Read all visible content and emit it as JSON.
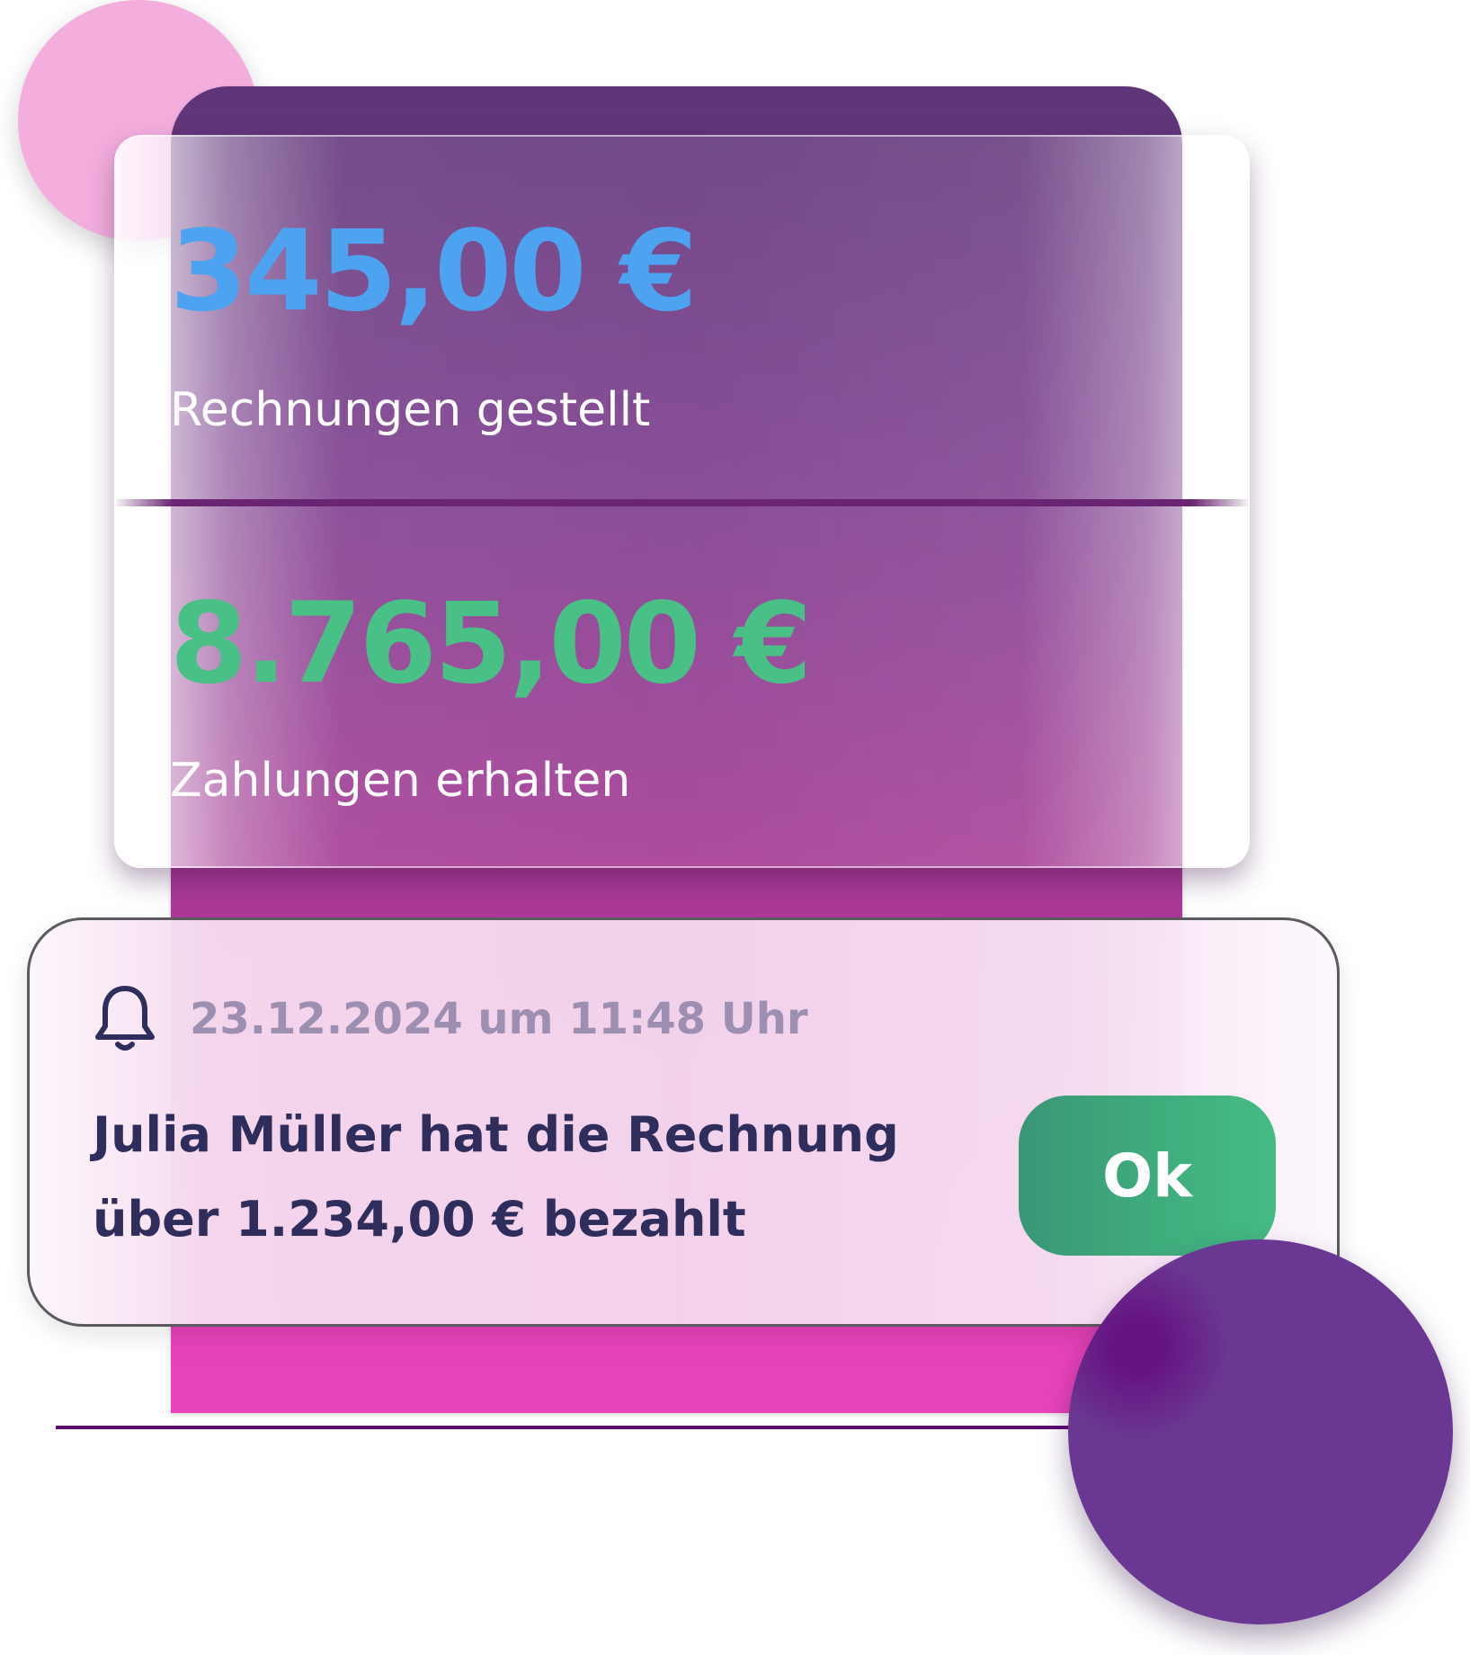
{
  "stats": {
    "invoiced_amount": "345,00 €",
    "invoiced_label": "Rechnungen gestellt",
    "received_amount": "8.765,00 €",
    "received_label": "Zahlungen erhalten"
  },
  "notification": {
    "icon": "bell-icon",
    "timestamp": "23.12.2024 um 11:48 Uhr",
    "message": "Julia Müller hat die Rechnung über 1.234,00 € bezahlt",
    "ok_label": "Ok"
  },
  "colors": {
    "invoiced_value": "#4da3f0",
    "received_value": "#49c186",
    "ok_button": "#3fab7c",
    "text_dark": "#2f2d5c",
    "text_muted": "#9d8fb1",
    "deco_pink": "#f3aede",
    "deco_purple": "#6a3892"
  }
}
